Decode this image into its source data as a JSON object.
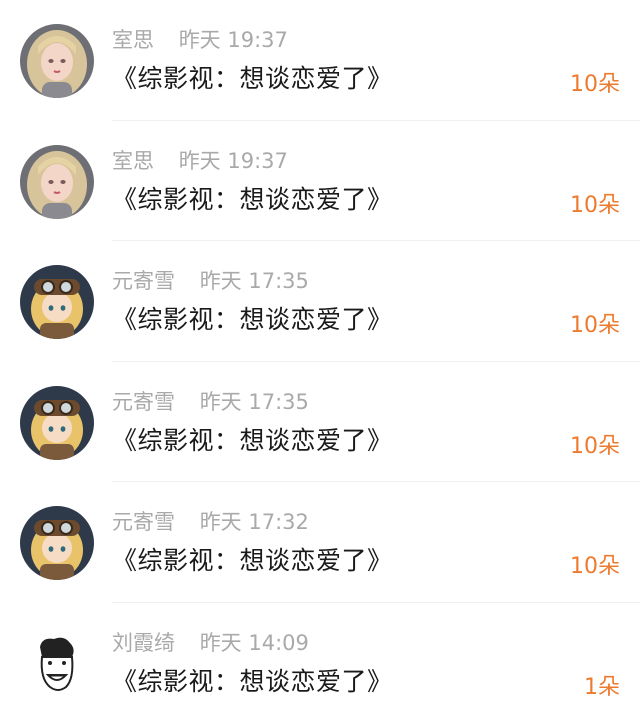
{
  "colors": {
    "accent_orange": "#ee7a2e",
    "meta_gray": "#a9a9a9",
    "text_dark": "#1a1a1a"
  },
  "entries": [
    {
      "user": "室思",
      "time": "昨天 19:37",
      "title": "《综影视：想谈恋爱了》",
      "gift": "10朵",
      "avatar_icon": "girl-avatar-icon"
    },
    {
      "user": "室思",
      "time": "昨天 19:37",
      "title": "《综影视：想谈恋爱了》",
      "gift": "10朵",
      "avatar_icon": "girl-avatar-icon"
    },
    {
      "user": "元寄雪",
      "time": "昨天 17:35",
      "title": "《综影视：想谈恋爱了》",
      "gift": "10朵",
      "avatar_icon": "aviator-avatar-icon"
    },
    {
      "user": "元寄雪",
      "time": "昨天 17:35",
      "title": "《综影视：想谈恋爱了》",
      "gift": "10朵",
      "avatar_icon": "aviator-avatar-icon"
    },
    {
      "user": "元寄雪",
      "time": "昨天 17:32",
      "title": "《综影视：想谈恋爱了》",
      "gift": "10朵",
      "avatar_icon": "aviator-avatar-icon"
    },
    {
      "user": "刘霞绮",
      "time": "昨天 14:09",
      "title": "《综影视：想谈恋爱了》",
      "gift": "1朵",
      "avatar_icon": "meme-face-avatar-icon"
    }
  ]
}
